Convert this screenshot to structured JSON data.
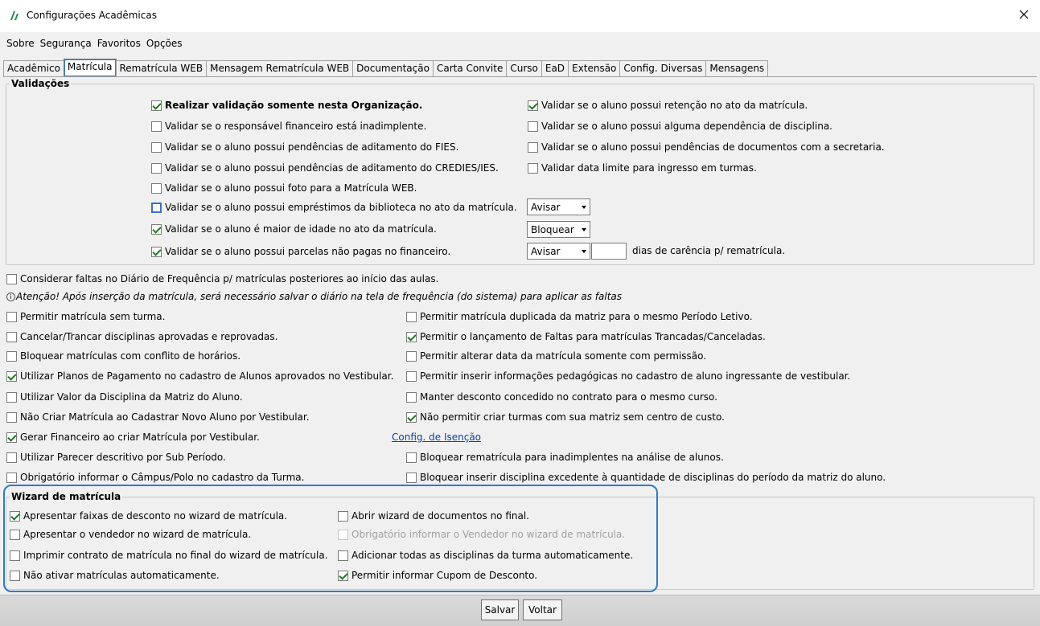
{
  "window": {
    "title": "Configurações Acadêmicas"
  },
  "menu": [
    "Sobre",
    "Segurança",
    "Favoritos",
    "Opções"
  ],
  "tabs": [
    "Acadêmico",
    "Matrícula",
    "Rematrícula WEB",
    "Mensagem Rematrícula WEB",
    "Documentação",
    "Carta Convite",
    "Curso",
    "EaD",
    "Extensão",
    "Config. Diversas",
    "Mensagens"
  ],
  "validacoes": {
    "title": "Validações",
    "left": [
      {
        "label": "Realizar validação somente nesta Organização.",
        "checked": true
      },
      {
        "label": "Validar se o responsável financeiro está inadimplente.",
        "checked": false
      },
      {
        "label": "Validar se o aluno possui pendências de aditamento do FIES.",
        "checked": false
      },
      {
        "label": "Validar se o aluno possui pendências de aditamento do CREDIES/IES.",
        "checked": false
      },
      {
        "label": "Validar se o aluno possui foto para a Matrícula WEB.",
        "checked": false
      },
      {
        "label": "Validar se o aluno possui empréstimos da biblioteca no ato da matrícula.",
        "checked": false
      },
      {
        "label": "Validar se o aluno é maior de idade no ato da matrícula.",
        "checked": true
      },
      {
        "label": "Validar se o aluno possui parcelas não pagas no financeiro.",
        "checked": true
      }
    ],
    "right": [
      {
        "label": "Validar se o aluno possui retenção no ato da matrícula.",
        "checked": true
      },
      {
        "label": "Validar se o aluno possui alguma dependência de disciplina.",
        "checked": false
      },
      {
        "label": "Validar se o aluno possui pendências de documentos com a secretaria.",
        "checked": false
      },
      {
        "label": "Validar data limite para ingresso em turmas.",
        "checked": false
      }
    ],
    "selects": [
      "Avisar",
      "Bloquear",
      "Avisar"
    ],
    "carencia_value": "",
    "carencia_label": "dias de carência p/ rematrícula."
  },
  "considerar": {
    "label": "Considerar faltas no Diário de Frequência p/ matrículas posteriores ao início das aulas.",
    "checked": false
  },
  "info_icon": "info-circle-icon",
  "atencao": "Atenção! Após inserção da matrícula, será necessário salvar o diário na tela de frequência (do sistema) para aplicar as faltas",
  "options_left": [
    {
      "label": "Permitir matrícula sem turma.",
      "checked": false
    },
    {
      "label": "Cancelar/Trancar disciplinas aprovadas e reprovadas.",
      "checked": false
    },
    {
      "label": "Bloquear matrículas com conflito de horários.",
      "checked": false
    },
    {
      "label": "Utilizar Planos de Pagamento no cadastro de Alunos aprovados no Vestibular.",
      "checked": true
    },
    {
      "label": "Utilizar Valor da Disciplina da Matriz do Aluno.",
      "checked": false
    },
    {
      "label": "Não Criar Matrícula ao Cadastrar Novo Aluno por Vestibular.",
      "checked": false
    },
    {
      "label": "Gerar Financeiro ao criar Matrícula por Vestibular.",
      "checked": true
    },
    {
      "label": "Utilizar Parecer descritivo por Sub Período.",
      "checked": false
    },
    {
      "label": "Obrigatório informar o Câmpus/Polo no cadastro da Turma.",
      "checked": false
    }
  ],
  "options_right": [
    {
      "label": "Permitir matrícula duplicada da matriz para o mesmo Período Letivo.",
      "checked": false
    },
    {
      "label": "Permitir o lançamento de Faltas para matrículas Trancadas/Canceladas.",
      "checked": true
    },
    {
      "label": "Permitir alterar data da matrícula somente com permissão.",
      "checked": false
    },
    {
      "label": "Permitir inserir informações pedagógicas no cadastro de aluno ingressante de vestibular.",
      "checked": false
    },
    {
      "label": "Manter desconto concedido no contrato para o mesmo curso.",
      "checked": false
    },
    {
      "label": "Não permitir criar turmas com sua matriz sem centro de custo.",
      "checked": true
    },
    {
      "label": "Bloquear rematrícula para inadimplentes na análise de alunos.",
      "checked": false
    },
    {
      "label": "Bloquear inserir disciplina excedente à quantidade de disciplinas do período da matriz do aluno.",
      "checked": false
    }
  ],
  "config_isencao": "Config. de Isenção",
  "wizard": {
    "title": "Wizard de matrícula",
    "left": [
      {
        "label": "Apresentar faixas de desconto no wizard de matrícula.",
        "checked": true
      },
      {
        "label": "Apresentar o vendedor no wizard de matrícula.",
        "checked": false
      },
      {
        "label": "Imprimir contrato de matrícula no final do wizard de matrícula.",
        "checked": false
      },
      {
        "label": "Não ativar matrículas automaticamente.",
        "checked": false
      }
    ],
    "right": [
      {
        "label": "Abrir wizard de documentos no final.",
        "checked": false
      },
      {
        "label": "Obrigatório informar o Vendedor no wizard de matrícula.",
        "checked": false,
        "disabled": true
      },
      {
        "label": "Adicionar todas as disciplinas da turma automaticamente.",
        "checked": false
      },
      {
        "label": "Permitir informar Cupom de Desconto.",
        "checked": true
      }
    ]
  },
  "buttons": {
    "save": "Salvar",
    "back": "Voltar"
  }
}
